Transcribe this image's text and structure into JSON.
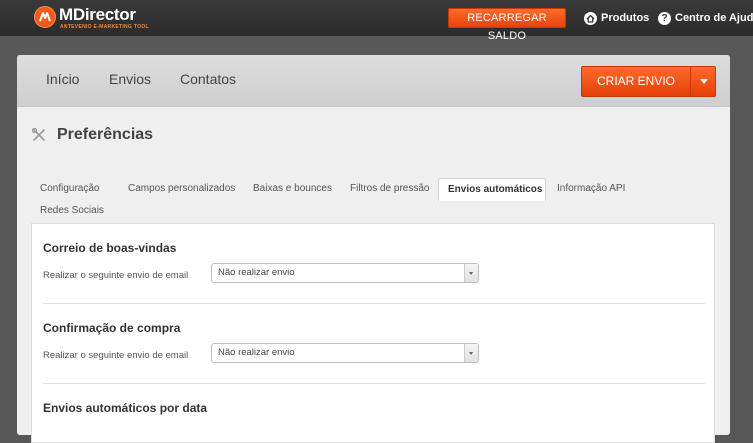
{
  "header": {
    "brand_name": "MDirector",
    "brand_tagline": "ANTEVENIO E-MARKETING TOOL",
    "recarregar_label": "RECARREGAR SALDO",
    "produtos_label": "Produtos",
    "ajuda_label": "Centro de Ajuda",
    "accent_color": "#f05a1a"
  },
  "nav": {
    "items": [
      {
        "label": "Início"
      },
      {
        "label": "Envios"
      },
      {
        "label": "Contatos"
      }
    ],
    "criar_label": "CRIAR ENVIO"
  },
  "page": {
    "title": "Preferências",
    "title_icon": "tools-icon"
  },
  "tabs": [
    {
      "label": "Configuração",
      "active": false
    },
    {
      "label": "Campos personalizados",
      "active": false
    },
    {
      "label": "Baixas e bounces",
      "active": false
    },
    {
      "label": "Filtros de pressão",
      "active": false
    },
    {
      "label": "Envios automáticos",
      "active": true
    },
    {
      "label": "Informação API",
      "active": false
    },
    {
      "label": "Redes Sociais",
      "active": false
    }
  ],
  "sections": [
    {
      "title": "Correio de boas-vindas",
      "field_label": "Realizar o seguinte envio de email",
      "select_value": "Não realizar envio"
    },
    {
      "title": "Confirmação de compra",
      "field_label": "Realizar o seguinte envio de email",
      "select_value": "Não realizar envio"
    },
    {
      "title": "Envios automáticos por data"
    }
  ]
}
